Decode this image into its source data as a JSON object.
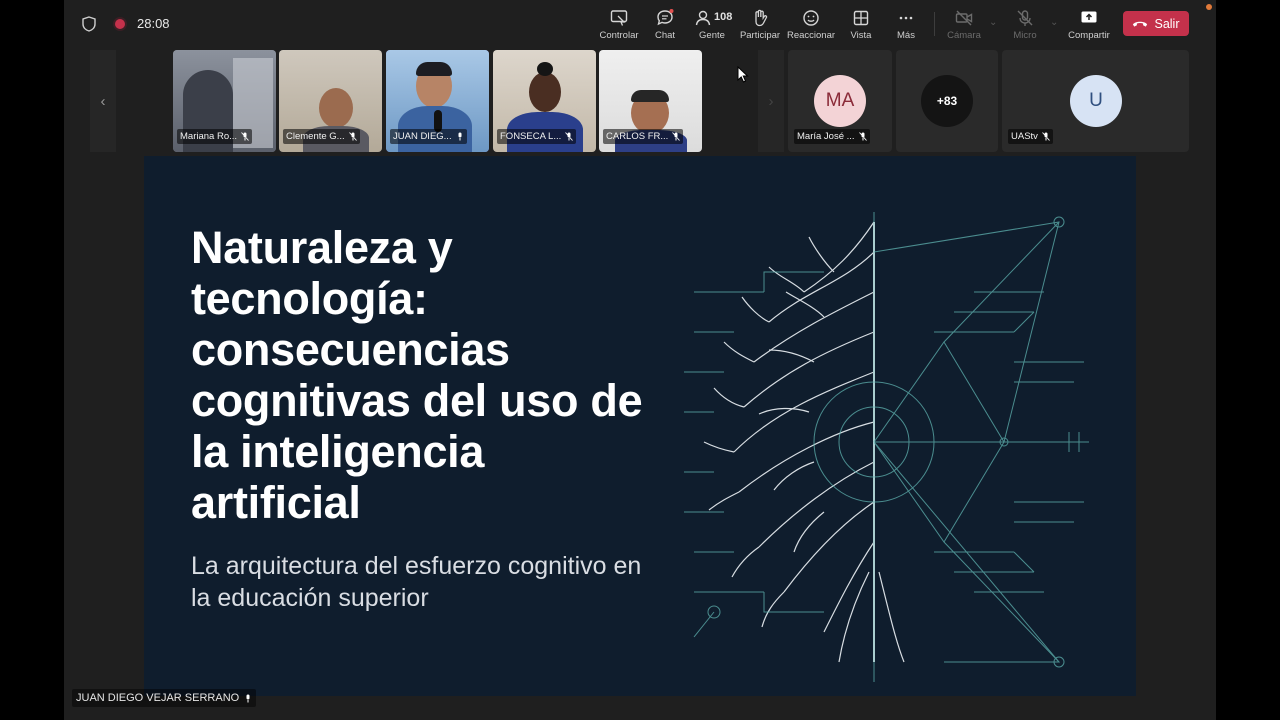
{
  "meeting": {
    "timer": "28:08",
    "colors": {
      "leave": "#c4314b",
      "active_outline": "#7b83eb",
      "slide_bg": "#0f1d2d"
    }
  },
  "toolbar": {
    "control_label": "Controlar",
    "chat_label": "Chat",
    "people_label": "Gente",
    "people_count": "108",
    "participate_label": "Participar",
    "react_label": "Reaccionar",
    "view_label": "Vista",
    "more_label": "Más",
    "camera_label": "Cámara",
    "mic_label": "Micro",
    "share_label": "Compartir",
    "leave_label": "Salir"
  },
  "gallery": {
    "tiles": [
      {
        "name": "Mariana Ro..."
      },
      {
        "name": "Clemente G..."
      },
      {
        "name": "JUAN DIEG..."
      },
      {
        "name": "FONSECA L..."
      },
      {
        "name": "CARLOS FR..."
      }
    ],
    "avatars": [
      {
        "initials": "MA",
        "name": "María José ...",
        "bg": "#f3d3d6",
        "fg": "#8a2a38"
      },
      {
        "initials": "+83",
        "name": "",
        "bg": "#141414",
        "fg": "#ffffff"
      },
      {
        "initials": "U",
        "name": "UAStv",
        "bg": "#d7e3f4",
        "fg": "#2f4f7f"
      }
    ]
  },
  "slide": {
    "title": "Naturaleza y tecnología: consecuencias cognitivas del uso de la inteligencia artificial",
    "subtitle": "La arquitectura del esfuerzo cognitivo en la educación superior"
  },
  "presenter": {
    "name": "JUAN DIEGO VEJAR SERRANO"
  }
}
